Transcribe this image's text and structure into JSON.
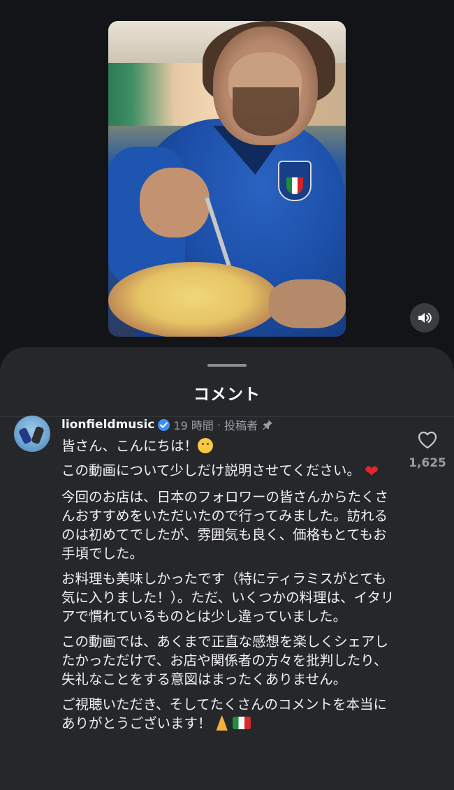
{
  "sheet": {
    "title": "コメント"
  },
  "comment": {
    "username": "lionfieldmusic",
    "time": "19 時間",
    "separator": "·",
    "author_tag": "投稿者",
    "likes": "1,625",
    "paragraphs": [
      "皆さん、こんにちは！",
      "この動画について少しだけ説明させてください。",
      "今回のお店は、日本のフォロワーの皆さんからたくさんおすすめをいただいたので行ってみました。訪れるのは初めてでしたが、雰囲気も良く、価格もとてもお手頃でした。",
      "お料理も美味しかったです（特にティラミスがとても気に入りました！）。ただ、いくつかの料理は、イタリアで慣れているものとは少し違っていました。",
      "この動画では、あくまで正直な感想を楽しくシェアしたかっただけで、お店や関係者の方々を批判したり、失礼なことをする意図はまったくありません。",
      "ご視聴いただき、そしてたくさんのコメントを本当にありがとうございます！"
    ]
  },
  "icons": {
    "mute": "speaker-icon",
    "verified": "verified-badge-icon",
    "pin": "pin-icon",
    "like": "heart-outline-icon"
  },
  "colors": {
    "background": "#121417",
    "sheet": "#25272b",
    "verified": "#3f8ff0",
    "muted_text": "#9a9da2"
  }
}
